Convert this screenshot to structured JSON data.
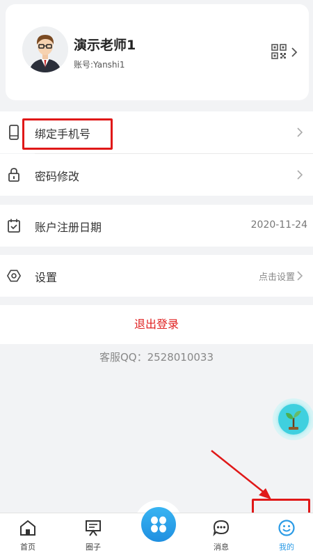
{
  "profile": {
    "name": "演示老师1",
    "account": "账号:Yanshi1"
  },
  "menu": {
    "bind_phone": "绑定手机号",
    "change_password": "密码修改",
    "register_date_label": "账户注册日期",
    "register_date_value": "2020-11-24",
    "settings_label": "设置",
    "settings_hint": "点击设置"
  },
  "logout_label": "退出登录",
  "service_text": "客服QQ：2528010033",
  "tabs": [
    {
      "label": "首页",
      "icon": "home-icon"
    },
    {
      "label": "圈子",
      "icon": "board-icon"
    },
    {
      "label": "",
      "icon": "apps-icon"
    },
    {
      "label": "消息",
      "icon": "message-icon"
    },
    {
      "label": "我的",
      "icon": "smile-icon",
      "active": true
    }
  ],
  "colors": {
    "accent": "#2b9be6",
    "logout": "#e02020",
    "highlight": "#e01818"
  }
}
